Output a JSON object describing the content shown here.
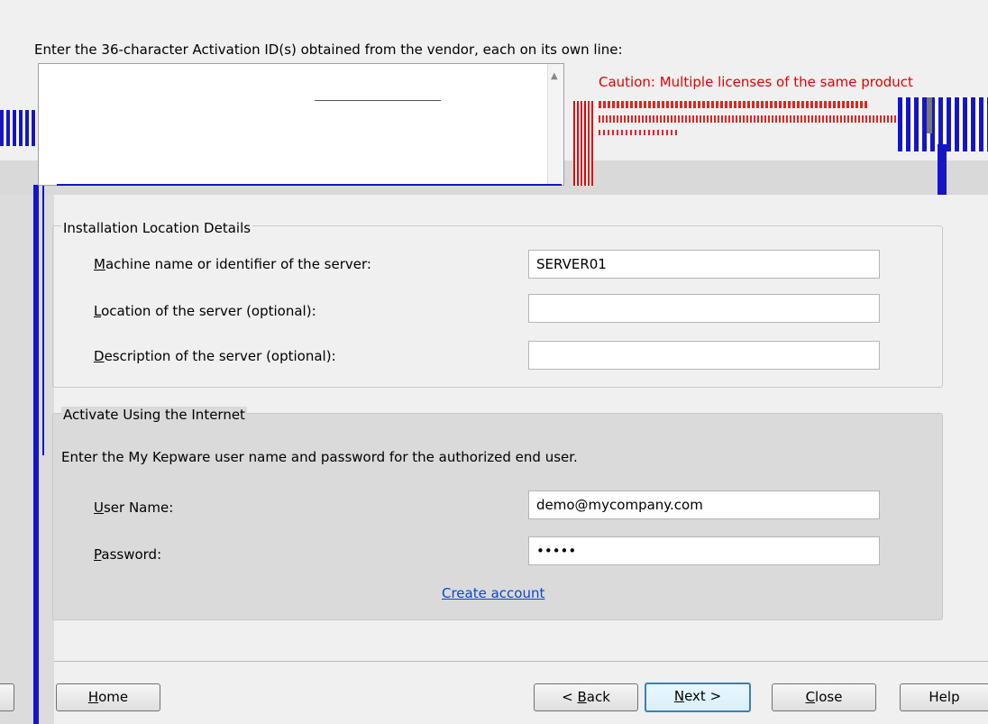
{
  "activation": {
    "caption": "Enter the 36-character Activation ID(s) obtained from the vendor, each on its own line:",
    "caution": "Caution: Multiple licenses of the same product"
  },
  "installation": {
    "title": "Installation Location Details",
    "machine_label": "Machine name or identifier of the server:",
    "machine_value": "SERVER01",
    "location_label": "Location of the server (optional):",
    "location_value": "",
    "description_label": "Description of the server (optional):",
    "description_value": ""
  },
  "internet": {
    "title": "Activate Using the Internet",
    "instruction": "Enter the My Kepware user name and password for the authorized end user.",
    "username_label": "User Name:",
    "username_value": "demo@mycompany.com",
    "password_label": "Password:",
    "password_value": "•••••",
    "create_account": "Create account"
  },
  "buttons": {
    "home": "Home",
    "back": "< Back",
    "next": "Next >",
    "close": "Close",
    "help": "Help"
  },
  "colors": {
    "caution": "#e00000",
    "link": "#0a46cc",
    "artifact_blue": "#1515c8"
  }
}
